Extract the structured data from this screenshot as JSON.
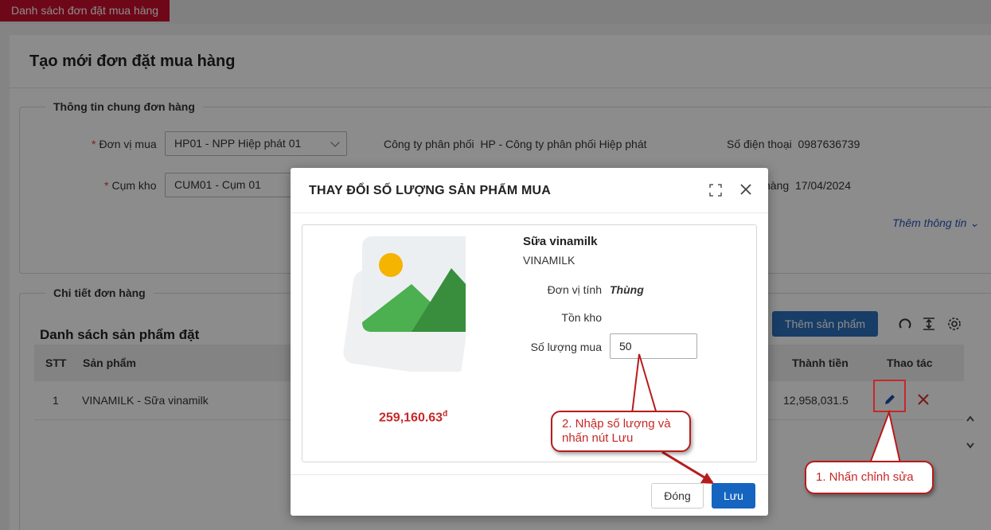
{
  "tabs": {
    "active_tab": "Danh sách đơn đặt mua hàng"
  },
  "page": {
    "title": "Tạo mới đơn đặt mua hàng"
  },
  "general": {
    "legend": "Thông tin chung đơn hàng",
    "unit_label": "Đơn vị mua",
    "unit_value": "HP01 - NPP Hiệp phát 01",
    "distributor_label": "Công ty phân phối",
    "distributor_value": "HP - Công ty phân phối Hiệp phát",
    "phone_label": "Số điện thoại",
    "phone_value": "0987636739",
    "warehouse_label": "Cụm kho",
    "warehouse_value": "CUM01 - Cụm 01",
    "date_label_partial": "hàng",
    "date_value": "17/04/2024",
    "more_info": "Thêm thông tin"
  },
  "detail": {
    "legend": "Chi tiết đơn hàng",
    "section_title": "Danh sách sản phẩm đặt",
    "add_button": "Thêm sản phẩm",
    "columns": {
      "stt": "STT",
      "product": "Sản phẩm",
      "total": "Thành tiền",
      "actions": "Thao tác"
    },
    "rows": [
      {
        "stt": "1",
        "product": "VINAMILK - Sữa vinamilk",
        "total": "12,958,031.5"
      }
    ]
  },
  "modal": {
    "title": "THAY ĐỔI SỐ LƯỢNG SẢN PHẨM MUA",
    "product_name": "Sữa vinamilk",
    "brand": "VINAMILK",
    "unit_label": "Đơn vị tính",
    "unit_value": "Thùng",
    "stock_label": "Tồn kho",
    "qty_label": "Số lượng mua",
    "qty_value": "50",
    "price": "259,160.63",
    "currency": "đ",
    "close_button": "Đóng",
    "save_button": "Lưu"
  },
  "annotations": {
    "step1": "1. Nhấn chỉnh sửa",
    "step2_line1": "2. Nhập số lượng và",
    "step2_line2": "nhấn nút Lưu"
  },
  "colors": {
    "brand_red": "#c8102e",
    "primary_blue": "#1565c0",
    "annotation_red": "#c62828"
  }
}
